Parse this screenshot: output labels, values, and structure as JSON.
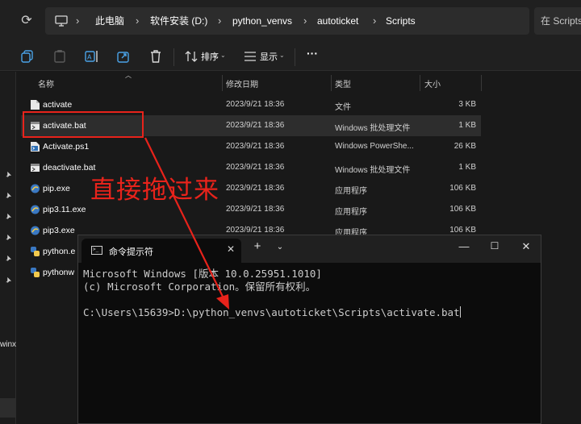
{
  "address_bar": {
    "breadcrumbs": [
      "此电脑",
      "软件安装 (D:)",
      "python_venvs",
      "autoticket",
      "Scripts"
    ],
    "search_placeholder": "在 Scripts"
  },
  "toolbar": {
    "sort_label": "排序",
    "view_label": "显示",
    "more_label": "···"
  },
  "columns": {
    "name": "名称",
    "date": "修改日期",
    "type": "类型",
    "size": "大小"
  },
  "files": [
    {
      "name": "activate",
      "date": "2023/9/21 18:36",
      "type": "文件",
      "size": "3 KB",
      "icon": "file-icon"
    },
    {
      "name": "activate.bat",
      "date": "2023/9/21 18:36",
      "type": "Windows 批处理文件",
      "size": "1 KB",
      "icon": "bat-icon"
    },
    {
      "name": "Activate.ps1",
      "date": "2023/9/21 18:36",
      "type": "Windows PowerShe...",
      "size": "26 KB",
      "icon": "ps1-icon"
    },
    {
      "name": "deactivate.bat",
      "date": "2023/9/21 18:36",
      "type": "Windows 批处理文件",
      "size": "1 KB",
      "icon": "bat-icon"
    },
    {
      "name": "pip.exe",
      "date": "2023/9/21 18:36",
      "type": "应用程序",
      "size": "106 KB",
      "icon": "exe-icon"
    },
    {
      "name": "pip3.11.exe",
      "date": "2023/9/21 18:36",
      "type": "应用程序",
      "size": "106 KB",
      "icon": "exe-icon"
    },
    {
      "name": "pip3.exe",
      "date": "2023/9/21 18:36",
      "type": "应用程序",
      "size": "106 KB",
      "icon": "exe-icon"
    },
    {
      "name": "python.e",
      "date": "",
      "type": "",
      "size": "",
      "icon": "python-icon"
    },
    {
      "name": "pythonw",
      "date": "",
      "type": "",
      "size": "",
      "icon": "python-icon"
    }
  ],
  "nav_pane": {
    "partial_label": "winx"
  },
  "annotation": {
    "text": "直接拖过来",
    "color": "#e8231b"
  },
  "cmd": {
    "tab_title": "命令提示符",
    "new_tab_label": "+",
    "lines": [
      "Microsoft Windows [版本 10.0.25951.1010]",
      "(c) Microsoft Corporation。保留所有权利。",
      "",
      "C:\\Users\\15639>D:\\python_venvs\\autoticket\\Scripts\\activate.bat"
    ]
  },
  "colors": {
    "explorer_bg": "#191919",
    "chrome_bg": "#202020",
    "selected_row": "#2d2d2d",
    "terminal_bg": "#0c0c0c",
    "terminal_text": "#cccccc"
  }
}
